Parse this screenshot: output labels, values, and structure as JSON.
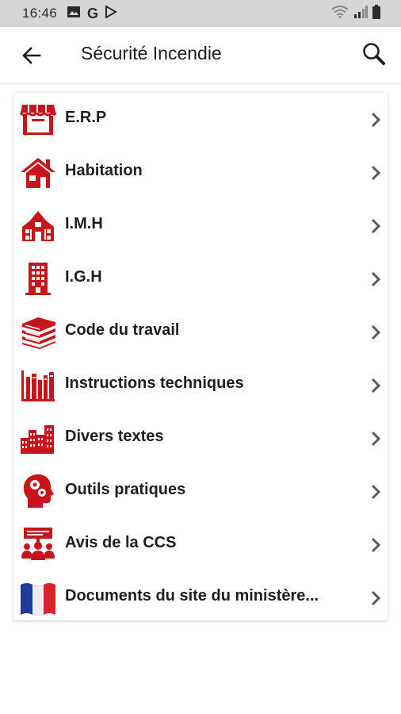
{
  "statusbar": {
    "time": "16:46",
    "left_icons": [
      "image-icon",
      "google-icon",
      "play-store-icon"
    ],
    "right_icons": [
      "wifi-icon",
      "signal-icon",
      "battery-icon"
    ]
  },
  "appbar": {
    "title": "Sécurité Incendie",
    "back_icon": "arrow-back-icon",
    "search_icon": "search-icon"
  },
  "colors": {
    "accent_red": "#c8141b",
    "text": "#1e1e1e",
    "chevron": "#5a5a5a",
    "statusbar_bg": "#d6d6d6"
  },
  "menu": {
    "items": [
      {
        "label": "E.R.P",
        "icon": "storefront-icon"
      },
      {
        "label": "Habitation",
        "icon": "house-icon"
      },
      {
        "label": "I.M.H",
        "icon": "school-building-icon"
      },
      {
        "label": "I.G.H",
        "icon": "tower-building-icon"
      },
      {
        "label": "Code du travail",
        "icon": "book-stack-icon"
      },
      {
        "label": "Instructions techniques",
        "icon": "bookshelf-icon"
      },
      {
        "label": "Divers textes",
        "icon": "city-buildings-icon"
      },
      {
        "label": "Outils pratiques",
        "icon": "head-gears-icon"
      },
      {
        "label": "Avis de la CCS",
        "icon": "meeting-board-icon"
      },
      {
        "label": "Documents du site du ministère...",
        "icon": "french-flag-icon"
      }
    ]
  }
}
